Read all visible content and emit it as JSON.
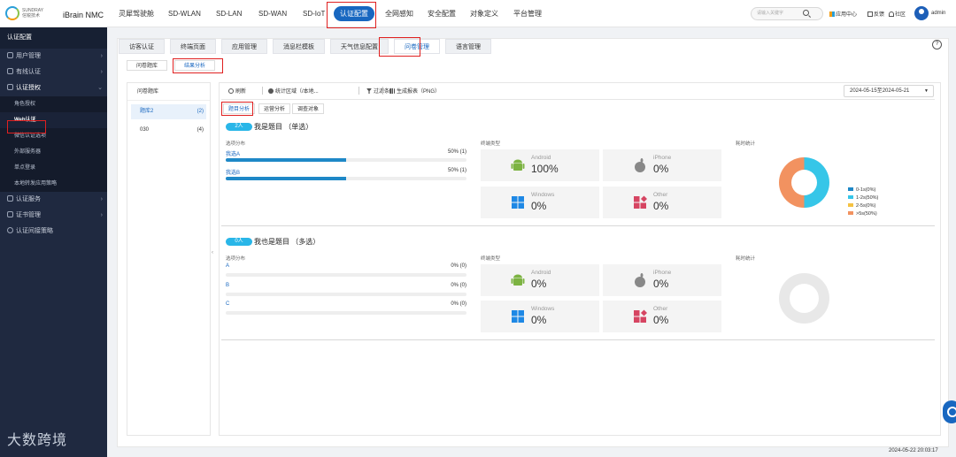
{
  "brand": {
    "company": "SUNDRAY\n信锐技术",
    "app": "iBrain NMC"
  },
  "nav": [
    {
      "label": "灵犀驾驶舱"
    },
    {
      "label": "SD-WLAN"
    },
    {
      "label": "SD-LAN"
    },
    {
      "label": "SD-WAN"
    },
    {
      "label": "SD-IoT"
    },
    {
      "label": "认证配置"
    },
    {
      "label": "全网感知"
    },
    {
      "label": "安全配置"
    },
    {
      "label": "对象定义"
    },
    {
      "label": "平台管理"
    }
  ],
  "header": {
    "search_placeholder": "请输入关键字",
    "app_center": "应用中心",
    "feedback": "反馈",
    "community": "社区",
    "user": "admin"
  },
  "sidebar": {
    "title": "认证配置",
    "items": [
      {
        "label": "用户管理"
      },
      {
        "label": "有线认证"
      },
      {
        "label": "认证授权"
      }
    ],
    "sub": [
      {
        "label": "角色授权"
      },
      {
        "label": "Web认证"
      },
      {
        "label": "微信认证选项"
      },
      {
        "label": "外部服务器"
      },
      {
        "label": "单点登录"
      },
      {
        "label": "本地转发应用策略"
      }
    ],
    "bottom": [
      {
        "label": "认证服务"
      },
      {
        "label": "证书管理"
      },
      {
        "label": "认证间接策略"
      }
    ]
  },
  "watermark": "大数跨境",
  "tabs": [
    {
      "label": "访客认证"
    },
    {
      "label": "终端页面"
    },
    {
      "label": "应用管理"
    },
    {
      "label": "消息栏模板"
    },
    {
      "label": "天气信息配置"
    },
    {
      "label": "问卷管理"
    },
    {
      "label": "语言管理"
    }
  ],
  "subtabs": [
    {
      "label": "问卷题库"
    },
    {
      "label": "结果分析"
    }
  ],
  "library": {
    "header": "问卷题库",
    "rows": [
      {
        "name": "题库2",
        "count": "(2)"
      },
      {
        "name": "030",
        "count": "(4)"
      }
    ]
  },
  "toolbar": {
    "refresh": "刷新",
    "stat_region": "统计区域（/本地...",
    "filter": "过滤条件",
    "report": "生成报表（PNG）",
    "date_range": "2024-05-15至2024-05-21"
  },
  "result_tabs": [
    {
      "label": "题目分析"
    },
    {
      "label": "运营分析"
    },
    {
      "label": "调查对象"
    }
  ],
  "labels": {
    "option_dist": "选项分布",
    "terminal_type": "终端类型",
    "time_stat": "耗时统计"
  },
  "questions": [
    {
      "badge": "2人",
      "title": "我是题目 （单选）",
      "options": [
        {
          "name": "我选A",
          "pct_text": "50% (1)",
          "fraction": 0.5
        },
        {
          "name": "我选B",
          "pct_text": "50% (1)",
          "fraction": 0.5
        }
      ],
      "terminals": [
        {
          "os": "Android",
          "pct": "100%",
          "icon": "android-icon"
        },
        {
          "os": "iPhone",
          "pct": "0%",
          "icon": "apple-icon"
        },
        {
          "os": "Windows",
          "pct": "0%",
          "icon": "windows-icon"
        },
        {
          "os": "Other",
          "pct": "0%",
          "icon": "other-icon"
        }
      ],
      "legend": [
        {
          "label": "0-1s(0%)",
          "color": "#1e88c7"
        },
        {
          "label": "1-2s(50%)",
          "color": "#36c6e8"
        },
        {
          "label": "2-5s(0%)",
          "color": "#f5c242"
        },
        {
          "label": ">5s(50%)",
          "color": "#f29260"
        }
      ]
    },
    {
      "badge": "0人",
      "title": "我也是题目 （多选）",
      "options": [
        {
          "name": "A",
          "pct_text": "0% (0)",
          "fraction": 0
        },
        {
          "name": "B",
          "pct_text": "0% (0)",
          "fraction": 0
        },
        {
          "name": "C",
          "pct_text": "0% (0)",
          "fraction": 0
        }
      ],
      "terminals": [
        {
          "os": "Android",
          "pct": "0%",
          "icon": "android-icon"
        },
        {
          "os": "iPhone",
          "pct": "0%",
          "icon": "apple-icon"
        },
        {
          "os": "Windows",
          "pct": "0%",
          "icon": "windows-icon"
        },
        {
          "os": "Other",
          "pct": "0%",
          "icon": "other-icon"
        }
      ]
    }
  ],
  "colors": {
    "accent": "#1867c0",
    "bar": "#1e88c7",
    "highlight": "#e02020",
    "android": "#7cb342",
    "windows": "#1e88e5",
    "other": "#d64562",
    "apple": "#888888"
  },
  "timestamp": "2024-05-22 20:03:17"
}
